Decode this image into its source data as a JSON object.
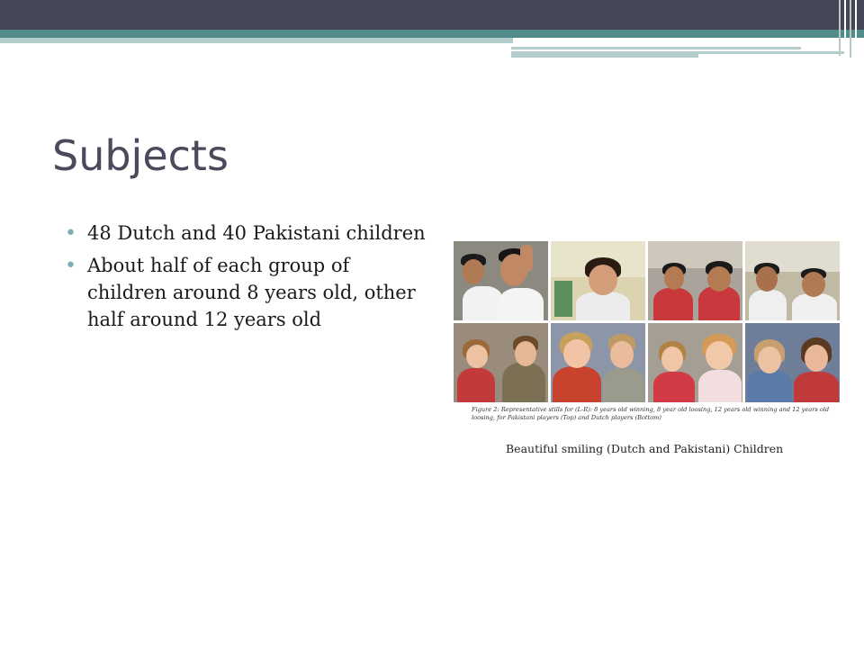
{
  "slide": {
    "title": "Subjects",
    "bullets": [
      "48 Dutch and 40 Pakistani children",
      "About half of each group of children around 8 years old, other half around 12 years old"
    ],
    "figure": {
      "figure_caption": "Figure 2: Representative stills for (L-R): 8 years old winning, 8 year old loosing, 12 years old winning and 12 years old loosing, for Pakistani players (Top) and Dutch players (Bottom)",
      "caption": "Beautiful smiling (Dutch and Pakistani) Children"
    }
  },
  "colors": {
    "band_dark": "#454759",
    "band_teal": "#4f8c8a",
    "bullet": "#7aaeb3",
    "title": "#4a4a5c"
  }
}
